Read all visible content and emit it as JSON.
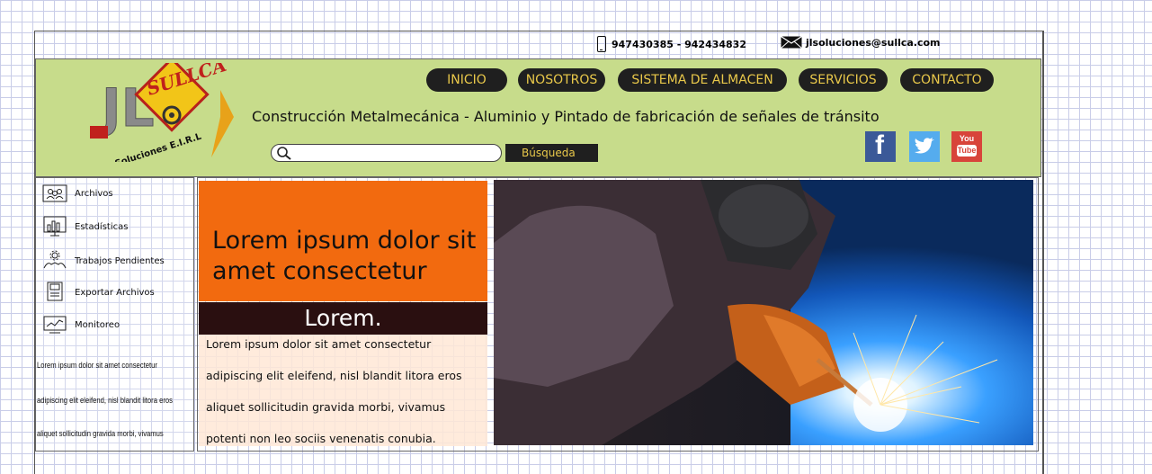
{
  "contact": {
    "phone": "947430385 - 942434832",
    "email": "jlsoluciones@sullca.com",
    "phone_icon": "phone-icon",
    "email_icon": "envelope-icon"
  },
  "logo": {
    "initials": "JL",
    "brand": "SULLCA",
    "subtitle": "Soluciones E.I.R.L"
  },
  "nav": [
    {
      "label": "INICIO"
    },
    {
      "label": "NOSOTROS"
    },
    {
      "label": "SISTEMA DE ALMACEN"
    },
    {
      "label": "SERVICIOS"
    },
    {
      "label": "CONTACTO"
    }
  ],
  "tagline": "Construcción Metalmecánica - Aluminio y Pintado de fabricación de señales de tránsito",
  "search": {
    "placeholder": "",
    "button_label": "Búsqueda"
  },
  "social": [
    {
      "name": "facebook",
      "glyph": "f",
      "color": "#3b5998"
    },
    {
      "name": "twitter",
      "glyph": "t",
      "color": "#55acee"
    },
    {
      "name": "youtube",
      "glyph_top": "You",
      "glyph_bottom": "Tube",
      "color": "#d8443a"
    }
  ],
  "sidebar": {
    "items": [
      {
        "label": "Archivos",
        "icon": "users-folder-icon"
      },
      {
        "label": "Estadísticas",
        "icon": "bar-chart-icon"
      },
      {
        "label": "Trabajos Pendientes",
        "icon": "gears-icon"
      },
      {
        "label": "Exportar Archivos",
        "icon": "floppy-disk-icon"
      },
      {
        "label": "Monitoreo",
        "icon": "monitor-icon"
      }
    ],
    "text_lines": [
      "Lorem ipsum dolor sit amet consectetur",
      "adipiscing elit eleifend, nisl blandit litora eros",
      "aliquet sollicitudin gravida morbi, vivamus"
    ]
  },
  "feature": {
    "title": "Lorem ipsum dolor sit amet consectetur",
    "band_label": "Lorem.",
    "lines": [
      "Lorem ipsum dolor sit amet consectetur",
      "adipiscing elit eleifend, nisl blandit litora eros",
      "aliquet sollicitudin gravida morbi, vivamus",
      "potenti non leo sociis venenatis conubia."
    ]
  },
  "colors": {
    "header_bg": "#c7dc8b",
    "nav_bg": "#1f1f1f",
    "nav_text": "#e9c84a",
    "feature_orange": "#f26a0f",
    "band_dark": "#2a0f10"
  }
}
